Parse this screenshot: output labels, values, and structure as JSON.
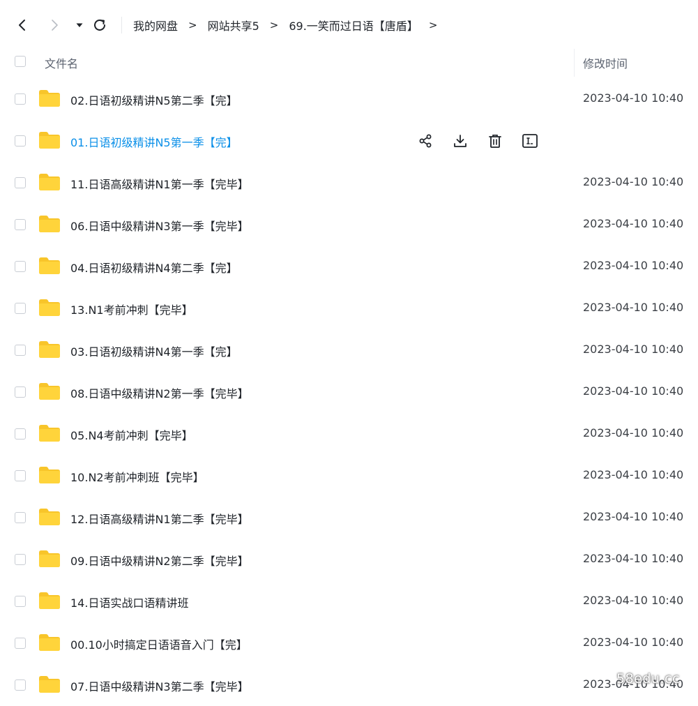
{
  "navigation": {
    "back_icon": "chevron-left-icon",
    "forward_icon": "chevron-right-icon",
    "history_icon": "caret-down-icon",
    "refresh_icon": "refresh-icon"
  },
  "breadcrumb": {
    "items": [
      "我的网盘",
      "网站共享5",
      "69.一笑而过日语【唐盾】"
    ],
    "separator": ">"
  },
  "columns": {
    "name": "文件名",
    "modified": "修改时间"
  },
  "files": [
    {
      "name": "02.日语初级精讲N5第二季【完】",
      "modified": "2023-04-10 10:40"
    },
    {
      "name": "01.日语初级精讲N5第一季【完】",
      "modified": ""
    },
    {
      "name": "11.日语高级精讲N1第一季【完毕】",
      "modified": "2023-04-10 10:40"
    },
    {
      "name": "06.日语中级精讲N3第一季【完毕】",
      "modified": "2023-04-10 10:40"
    },
    {
      "name": "04.日语初级精讲N4第二季【完】",
      "modified": "2023-04-10 10:40"
    },
    {
      "name": "13.N1考前冲刺【完毕】",
      "modified": "2023-04-10 10:40"
    },
    {
      "name": "03.日语初级精讲N4第一季【完】",
      "modified": "2023-04-10 10:40"
    },
    {
      "name": "08.日语中级精讲N2第一季【完毕】",
      "modified": "2023-04-10 10:40"
    },
    {
      "name": "05.N4考前冲刺【完毕】",
      "modified": "2023-04-10 10:40"
    },
    {
      "name": "10.N2考前冲刺班【完毕】",
      "modified": "2023-04-10 10:40"
    },
    {
      "name": "12.日语高级精讲N1第二季【完毕】",
      "modified": "2023-04-10 10:40"
    },
    {
      "name": "09.日语中级精讲N2第二季【完毕】",
      "modified": "2023-04-10 10:40"
    },
    {
      "name": "14.日语实战口语精讲班",
      "modified": "2023-04-10 10:40"
    },
    {
      "name": "00.10小时搞定日语语音入门【完】",
      "modified": "2023-04-10 10:40"
    },
    {
      "name": "07.日语中级精讲N3第二季【完毕】",
      "modified": "2023-04-10 10:40"
    }
  ],
  "hovered_row_index": 1,
  "row_actions": [
    "share-icon",
    "download-icon",
    "delete-icon",
    "rename-icon"
  ],
  "watermark": "58edu.cc",
  "colors": {
    "folder": "#ffd43b",
    "folder_back": "#f8c52a",
    "hover_link": "#0a8fe8",
    "text": "#1f2329",
    "muted": "#5c6370"
  }
}
